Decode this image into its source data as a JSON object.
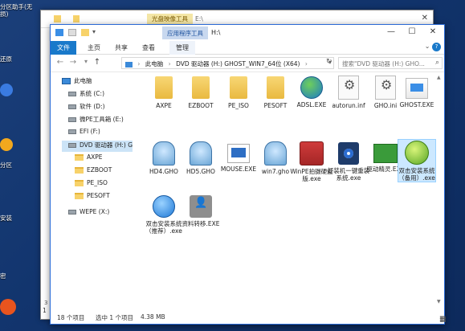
{
  "desktop": {
    "icons": [
      {
        "label": "分区助手(无损)"
      },
      {
        "label": "还原"
      },
      {
        "label": ""
      },
      {
        "label": "分区"
      },
      {
        "label": "安装"
      },
      {
        "label": "密"
      },
      {
        "label": ""
      }
    ]
  },
  "bg_window": {
    "context_tab": "光盘映像工具",
    "path": "E:\\",
    "tab_letter": "文",
    "left_number": "3",
    "status_left": "1"
  },
  "window": {
    "context_tab": "应用程序工具",
    "path": "H:\\",
    "ribbon_tabs": {
      "file": "文件",
      "home": "主页",
      "share": "共享",
      "view": "查看",
      "manage": "管理"
    },
    "help_icon": "?",
    "address": {
      "part1": "此电脑",
      "part2": "DVD 驱动器 (H:) GHOST_WIN7_64位 (X64)",
      "search_placeholder": "搜索\"DVD 驱动器 (H:) GHO..."
    },
    "nav": [
      {
        "label": "此电脑",
        "icon": "pc-icon"
      },
      {
        "label": "系统 (C:)",
        "icon": "drive-icon"
      },
      {
        "label": "软件 (D:)",
        "icon": "drive-icon"
      },
      {
        "label": "微PE工具箱 (E:)",
        "icon": "drive-icon"
      },
      {
        "label": "EFI (F:)",
        "icon": "drive-icon"
      },
      {
        "label": "DVD 驱动器 (H:) G",
        "icon": "drive-icon"
      },
      {
        "label": "AXPE",
        "icon": "folder-icon"
      },
      {
        "label": "EZBOOT",
        "icon": "folder-icon"
      },
      {
        "label": "PE_ISO",
        "icon": "folder-icon"
      },
      {
        "label": "PESOFT",
        "icon": "folder-icon"
      },
      {
        "label": "WEPE (X:)",
        "icon": "drive-icon"
      }
    ],
    "files": [
      {
        "name": "AXPE",
        "icon": "folder-icon"
      },
      {
        "name": "EZBOOT",
        "icon": "folder-icon"
      },
      {
        "name": "PE_ISO",
        "icon": "folder-icon"
      },
      {
        "name": "PESOFT",
        "icon": "folder-icon"
      },
      {
        "name": "ADSL.EXE",
        "icon": "globe-icon"
      },
      {
        "name": "autorun.inf",
        "icon": "gear-file-icon"
      },
      {
        "name": "GHO.ini",
        "icon": "gear-file-icon"
      },
      {
        "name": "GHOST.EXE",
        "icon": "exe-icon"
      },
      {
        "name": "HD4.GHO",
        "icon": "ghost-icon"
      },
      {
        "name": "HD5.GHO",
        "icon": "ghost-icon"
      },
      {
        "name": "MOUSE.EXE",
        "icon": "screen-icon"
      },
      {
        "name": "win7.gho",
        "icon": "ghost-icon"
      },
      {
        "name": "WinPE拍摄硬盘版.exe",
        "icon": "tools-icon"
      },
      {
        "name": "好装机一键重装系统.exe",
        "icon": "eye-icon"
      },
      {
        "name": "驱动精灵.EXE",
        "icon": "board-icon"
      },
      {
        "name": "双击安装系统（备用）.exe",
        "icon": "green-icon"
      },
      {
        "name": "双击安装系统（推荐）.exe",
        "icon": "blue-icon"
      },
      {
        "name": "资料转移.EXE",
        "icon": "user-icon"
      }
    ],
    "status": {
      "count": "18 个项目",
      "selected": "选中 1 个项目",
      "size": "4.38 MB"
    }
  }
}
